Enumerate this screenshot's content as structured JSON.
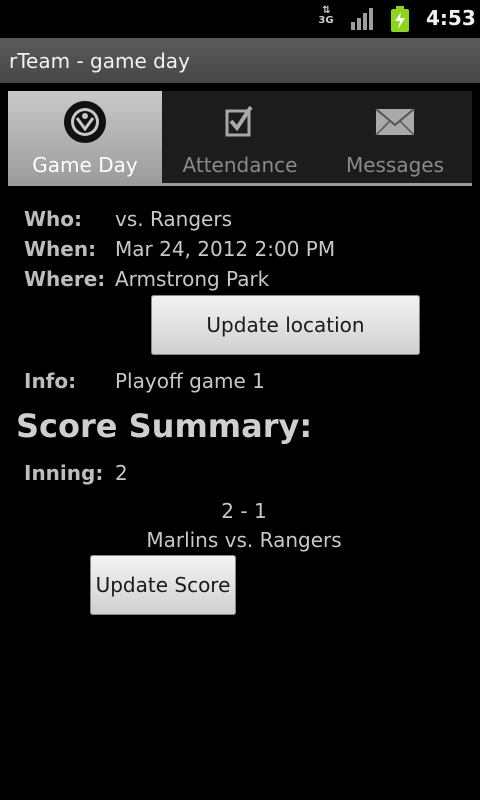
{
  "status_bar": {
    "network_type": "3G",
    "signal_icon": "signal-bars-icon",
    "battery_icon": "battery-charging-icon",
    "time": "4:53"
  },
  "app": {
    "title": "rTeam - game day"
  },
  "tabs": [
    {
      "label": "Game Day",
      "icon": "team-logo-icon",
      "active": true
    },
    {
      "label": "Attendance",
      "icon": "checkbox-icon",
      "active": false
    },
    {
      "label": "Messages",
      "icon": "envelope-icon",
      "active": false
    }
  ],
  "game": {
    "who_label": "Who:",
    "who_value": "vs. Rangers",
    "when_label": "When:",
    "when_value": "Mar 24, 2012 2:00 PM",
    "where_label": "Where:",
    "where_value": "Armstrong Park",
    "update_location_label": "Update location",
    "info_label": "Info:",
    "info_value": "Playoff game 1"
  },
  "score": {
    "section_title": "Score Summary:",
    "inning_label": "Inning:",
    "inning_value": "2",
    "home_score": "2",
    "separator": "-",
    "away_score": "1",
    "home_team": "Marlins",
    "vs_text": "vs.",
    "away_team": "Rangers",
    "update_score_label": "Update Score"
  }
}
